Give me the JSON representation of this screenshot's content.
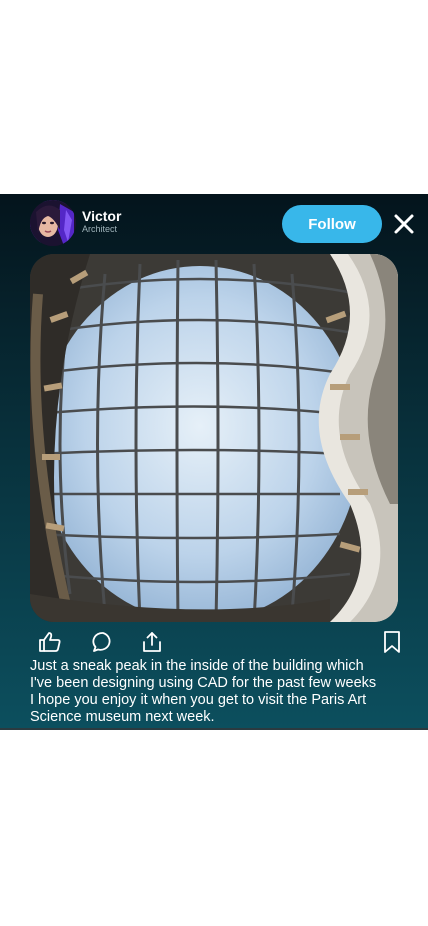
{
  "post": {
    "user": {
      "name": "Victor",
      "role": "Architect"
    },
    "follow_label": "Follow",
    "caption_lines": [
      "Just a sneak peak in the inside of the building which",
      "I've been designing using CAD for the past few weeks",
      "I hope you enjoy it when you get to visit the Paris Art",
      "Science museum next week."
    ]
  },
  "icons": {
    "close": "close-icon",
    "like": "thumbs-up-icon",
    "comment": "comment-bubble-icon",
    "share": "share-icon",
    "save": "bookmark-icon"
  },
  "colors": {
    "follow_button": "#38b7ea",
    "card_background_top": "#04141c",
    "card_background_bottom": "#0c4f5e",
    "text": "#ffffff"
  }
}
